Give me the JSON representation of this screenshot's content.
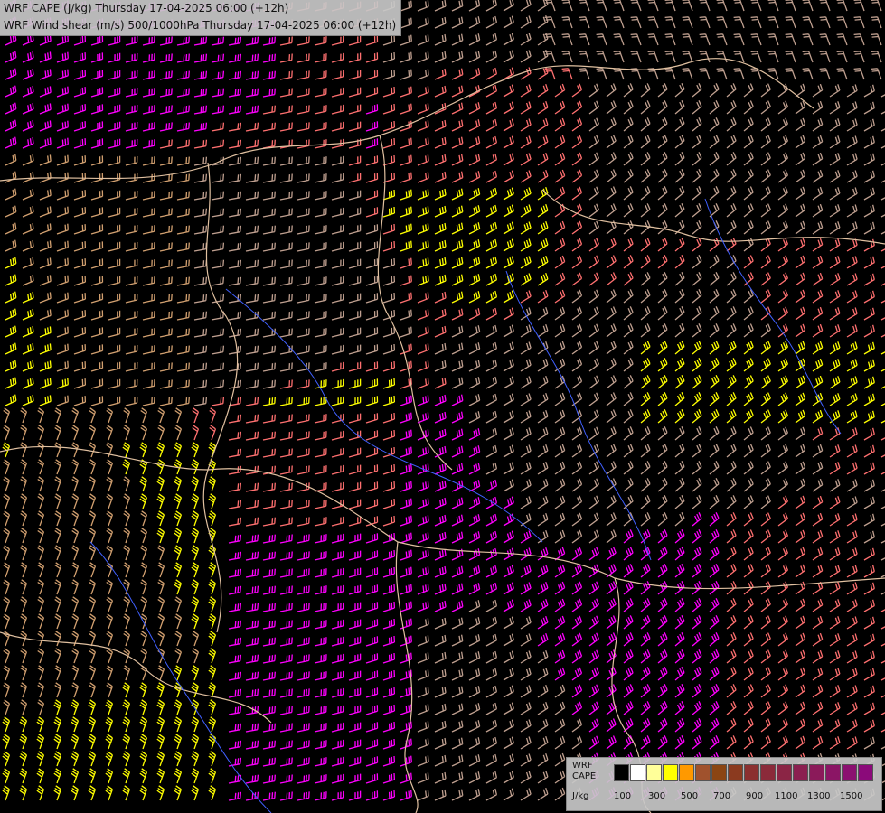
{
  "title": {
    "line1": "WRF CAPE (J/kg) Thursday 17-04-2025 06:00 (+12h)",
    "line2": "WRF Wind shear (m/s) 500/1000hPa Thursday 17-04-2025 06:00 (+12h)"
  },
  "legend": {
    "label_lines": [
      "WRF",
      "CAPE",
      "J/kg"
    ],
    "swatch_colors": [
      "#000000",
      "#ffffff",
      "#ffff99",
      "#ffff00",
      "#ff9900",
      "#a0522d",
      "#8b4513",
      "#8b3a1f",
      "#8b2f2f",
      "#8b2a3a",
      "#8b2545",
      "#8b2050",
      "#8b1a5a",
      "#8b1565",
      "#8b1070",
      "#8b0a7a"
    ],
    "tick_labels": [
      "100",
      "300",
      "500",
      "700",
      "900",
      "1100",
      "1300",
      "1500"
    ]
  },
  "map": {
    "content": "wind shear barbs over central Europe with CAPE shading",
    "barb_colors": {
      "weak": "#c0a090",
      "moderate": "#ff7070",
      "strong_yellow": "#ffff00",
      "strong_magenta": "#ff00ff",
      "tan": "#d2a070"
    },
    "border_color": "#e0c0a0",
    "river_color": "#4060ff"
  }
}
